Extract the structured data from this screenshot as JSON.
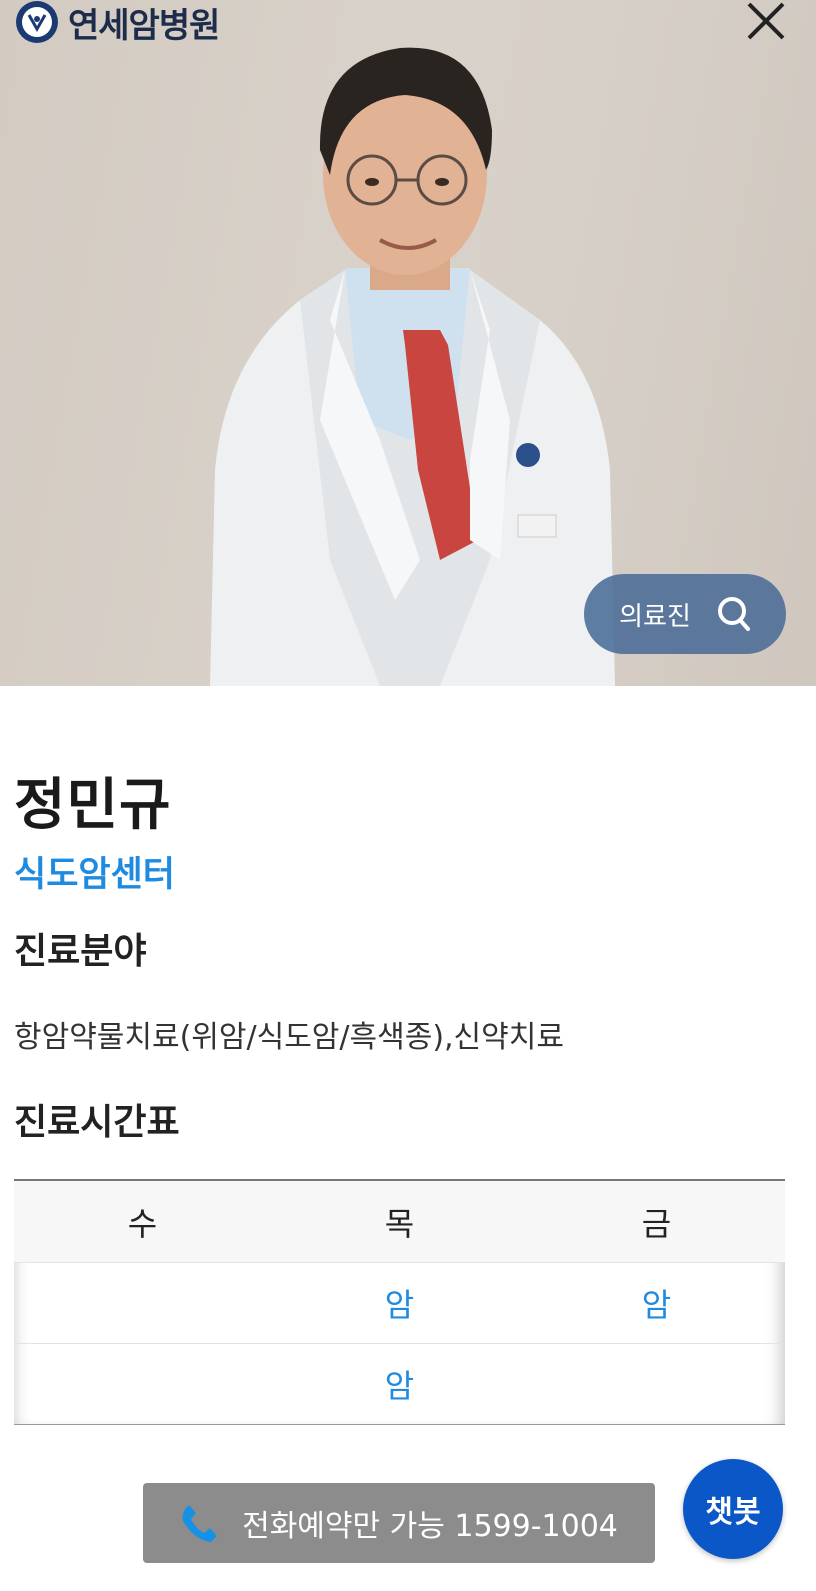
{
  "header": {
    "logo_text": "연세암병원",
    "logo_icon": "yonsei-emblem-icon",
    "close_icon": "close-icon"
  },
  "hero": {
    "photo": "doctor-portrait",
    "doctors_button_label": "의료진",
    "doctors_button_icon": "search-icon"
  },
  "doctor": {
    "name": "정민규",
    "department": "식도암센터"
  },
  "fields": {
    "title": "진료분야",
    "text": "항암약물치료(위암/식도암/흑색종),신약치료"
  },
  "schedule": {
    "title": "진료시간표",
    "days": [
      "수",
      "목",
      "금"
    ],
    "rows": [
      [
        "",
        "암",
        "암"
      ],
      [
        "",
        "암",
        ""
      ]
    ]
  },
  "footer": {
    "phone_label": "전화예약만 가능 1599-1004",
    "phone_icon": "phone-icon",
    "chatbot_label": "챗봇"
  },
  "colors": {
    "accent": "#1f8be0",
    "chatbot": "#0b57c8",
    "doctors_button": "#4a6c96",
    "phone_button": "#8c8c8c"
  }
}
